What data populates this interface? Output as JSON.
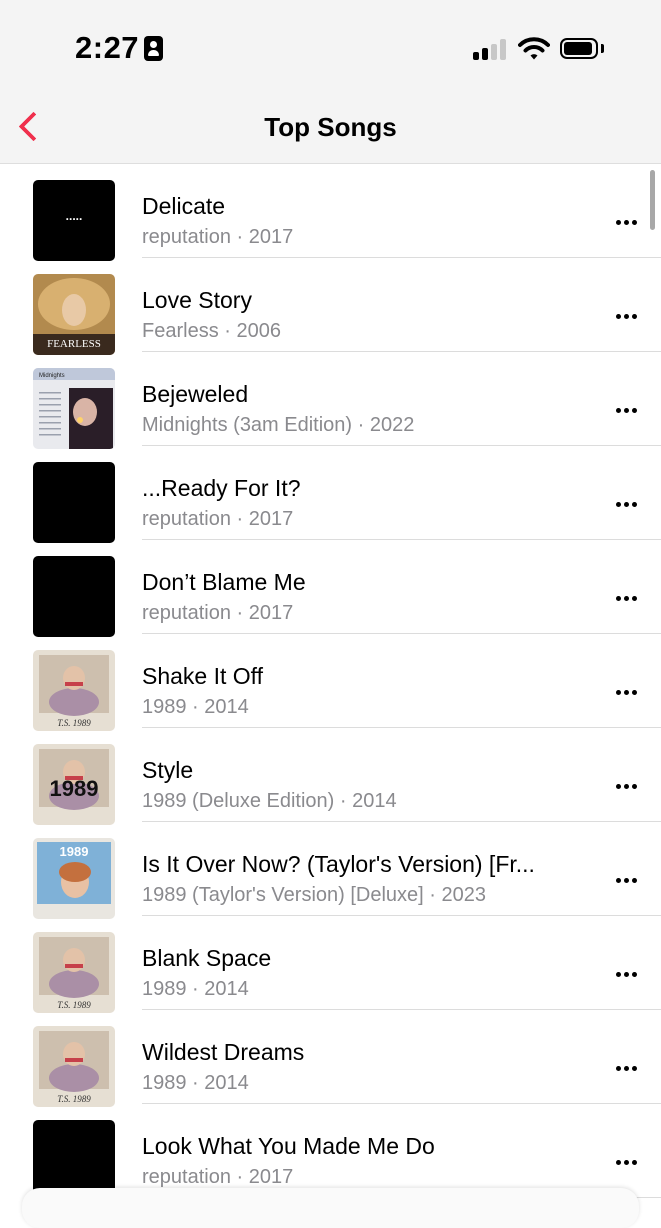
{
  "status_bar": {
    "time": "2:27",
    "icons": [
      "id-badge-icon",
      "cellular-signal-icon",
      "wifi-icon",
      "battery-icon"
    ]
  },
  "nav": {
    "back_icon": "chevron-left-icon",
    "title": "Top Songs"
  },
  "colors": {
    "accent": "#f0304d",
    "secondary_text": "#8a8a8e",
    "divider": "#dcdcdc",
    "bar_background": "#f4f4f4"
  },
  "songs": [
    {
      "title": "Delicate",
      "subtitle": "reputation · 2017",
      "art": "reputation-dots",
      "art_text": "....."
    },
    {
      "title": "Love Story",
      "subtitle": "Fearless · 2006",
      "art": "fearless",
      "art_text": "FEARLESS"
    },
    {
      "title": "Bejeweled",
      "subtitle": "Midnights (3am Edition) · 2022",
      "art": "midnights",
      "art_text": "Midnights"
    },
    {
      "title": "...Ready For It?",
      "subtitle": "reputation · 2017",
      "art": "reputation",
      "art_text": ""
    },
    {
      "title": "Don’t Blame Me",
      "subtitle": "reputation · 2017",
      "art": "reputation",
      "art_text": ""
    },
    {
      "title": "Shake It Off",
      "subtitle": "1989 · 2014",
      "art": "1989",
      "art_text": "T.S.   1989"
    },
    {
      "title": "Style",
      "subtitle": "1989 (Deluxe Edition) · 2014",
      "art": "1989-deluxe",
      "art_text": "1989"
    },
    {
      "title": "Is It Over Now? (Taylor's Version) [Fr...",
      "subtitle": "1989 (Taylor's Version) [Deluxe] · 2023",
      "art": "1989-tv",
      "art_text": "1989"
    },
    {
      "title": "Blank Space",
      "subtitle": "1989 · 2014",
      "art": "1989",
      "art_text": "T.S.   1989"
    },
    {
      "title": "Wildest Dreams",
      "subtitle": "1989 · 2014",
      "art": "1989",
      "art_text": "T.S.   1989"
    },
    {
      "title": "Look What You Made Me Do",
      "subtitle": "reputation · 2017",
      "art": "reputation",
      "art_text": ""
    }
  ]
}
